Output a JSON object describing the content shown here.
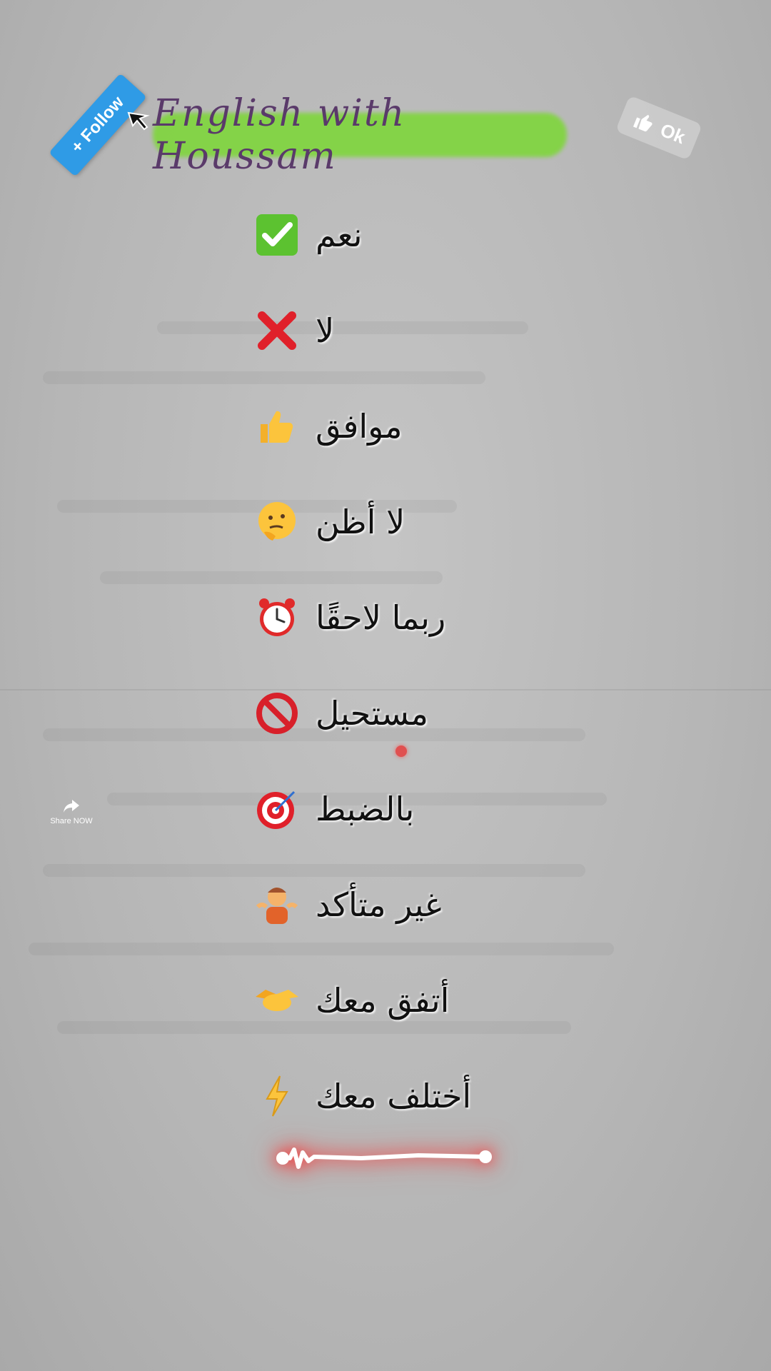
{
  "follow_button": {
    "label": "+ Follow"
  },
  "title": "English with Houssam",
  "ok_badge": {
    "label": "Ok",
    "icon": "thumbs-up-icon"
  },
  "phrases": [
    {
      "text": "نعم",
      "emoji": "check-mark-icon"
    },
    {
      "text": "لا",
      "emoji": "cross-mark-icon"
    },
    {
      "text": "موافق",
      "emoji": "thumbs-up-icon"
    },
    {
      "text": "لا أظن",
      "emoji": "thinking-face-icon"
    },
    {
      "text": "ربما لاحقًا",
      "emoji": "alarm-clock-icon"
    },
    {
      "text": "مستحيل",
      "emoji": "prohibited-icon"
    },
    {
      "text": "بالضبط",
      "emoji": "bullseye-icon"
    },
    {
      "text": "غير متأكد",
      "emoji": "shrug-icon"
    },
    {
      "text": "أتفق معك",
      "emoji": "handshake-icon"
    },
    {
      "text": "أختلف معك",
      "emoji": "lightning-icon"
    }
  ],
  "share": {
    "label": "Share NOW",
    "icon": "share-arrow-icon"
  },
  "colors": {
    "follow_bg": "#2f9be6",
    "title_highlight": "#7fd63c",
    "wave_glow": "#ff2828"
  }
}
